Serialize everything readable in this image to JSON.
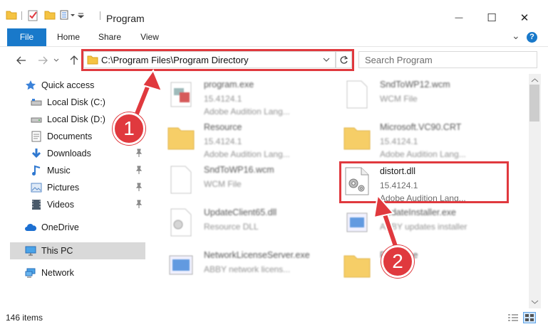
{
  "window": {
    "title": "Program",
    "minimize_glyph": "—",
    "maximize_glyph": "☐",
    "close_glyph": "✕"
  },
  "ribbon": {
    "tabs": [
      "File",
      "Home",
      "Share",
      "View"
    ],
    "help_glyph": "?",
    "expand_glyph": "⌄"
  },
  "address": {
    "path": "C:\\Program Files\\Program Directory",
    "search_placeholder": "Search Program"
  },
  "sidebar": {
    "items": [
      {
        "label": "Quick access",
        "icon": "star-icon"
      },
      {
        "label": "Local Disk (C:)",
        "icon": "drive-icon"
      },
      {
        "label": "Local Disk (D:)",
        "icon": "drive-icon"
      },
      {
        "label": "Documents",
        "icon": "documents-icon"
      },
      {
        "label": "Downloads",
        "icon": "download-icon"
      },
      {
        "label": "Music",
        "icon": "music-icon"
      },
      {
        "label": "Pictures",
        "icon": "pictures-icon"
      },
      {
        "label": "Videos",
        "icon": "video-icon"
      },
      {
        "label": "OneDrive",
        "icon": "cloud-icon"
      },
      {
        "label": "This PC",
        "icon": "computer-icon"
      },
      {
        "label": "Network",
        "icon": "network-icon"
      }
    ]
  },
  "files": [
    {
      "name": "program.exe",
      "version": "15.4124.1",
      "desc": "Adobe Audition Lang..."
    },
    {
      "name": "SndToWP12.wcm",
      "version": "WCM File",
      "desc": ""
    },
    {
      "name": "Resource",
      "version": "15.4124.1",
      "desc": "Adobe Audition Lang..."
    },
    {
      "name": "Microsoft.VC90.CRT",
      "version": "15.4124.1",
      "desc": "Adobe Audition Lang..."
    },
    {
      "name": "SndToWP16.wcm",
      "version": "WCM File",
      "desc": ""
    },
    {
      "name": "distort.dll",
      "version": "15.4124.1",
      "desc": "Adobe Audition Lang..."
    },
    {
      "name": "UpdateClient65.dll",
      "version": "Resource DLL",
      "desc": ""
    },
    {
      "name": "UpdateInstaller.exe",
      "version": "ABBY updates installer",
      "desc": ""
    },
    {
      "name": "NetworkLicenseServer.exe",
      "version": "ABBY network licens...",
      "desc": ""
    },
    {
      "name": "Resource",
      "version": "",
      "desc": ""
    }
  ],
  "status": {
    "item_count": "146 items"
  },
  "annotations": {
    "step1": "1",
    "step2": "2",
    "color": "#e0393e"
  }
}
